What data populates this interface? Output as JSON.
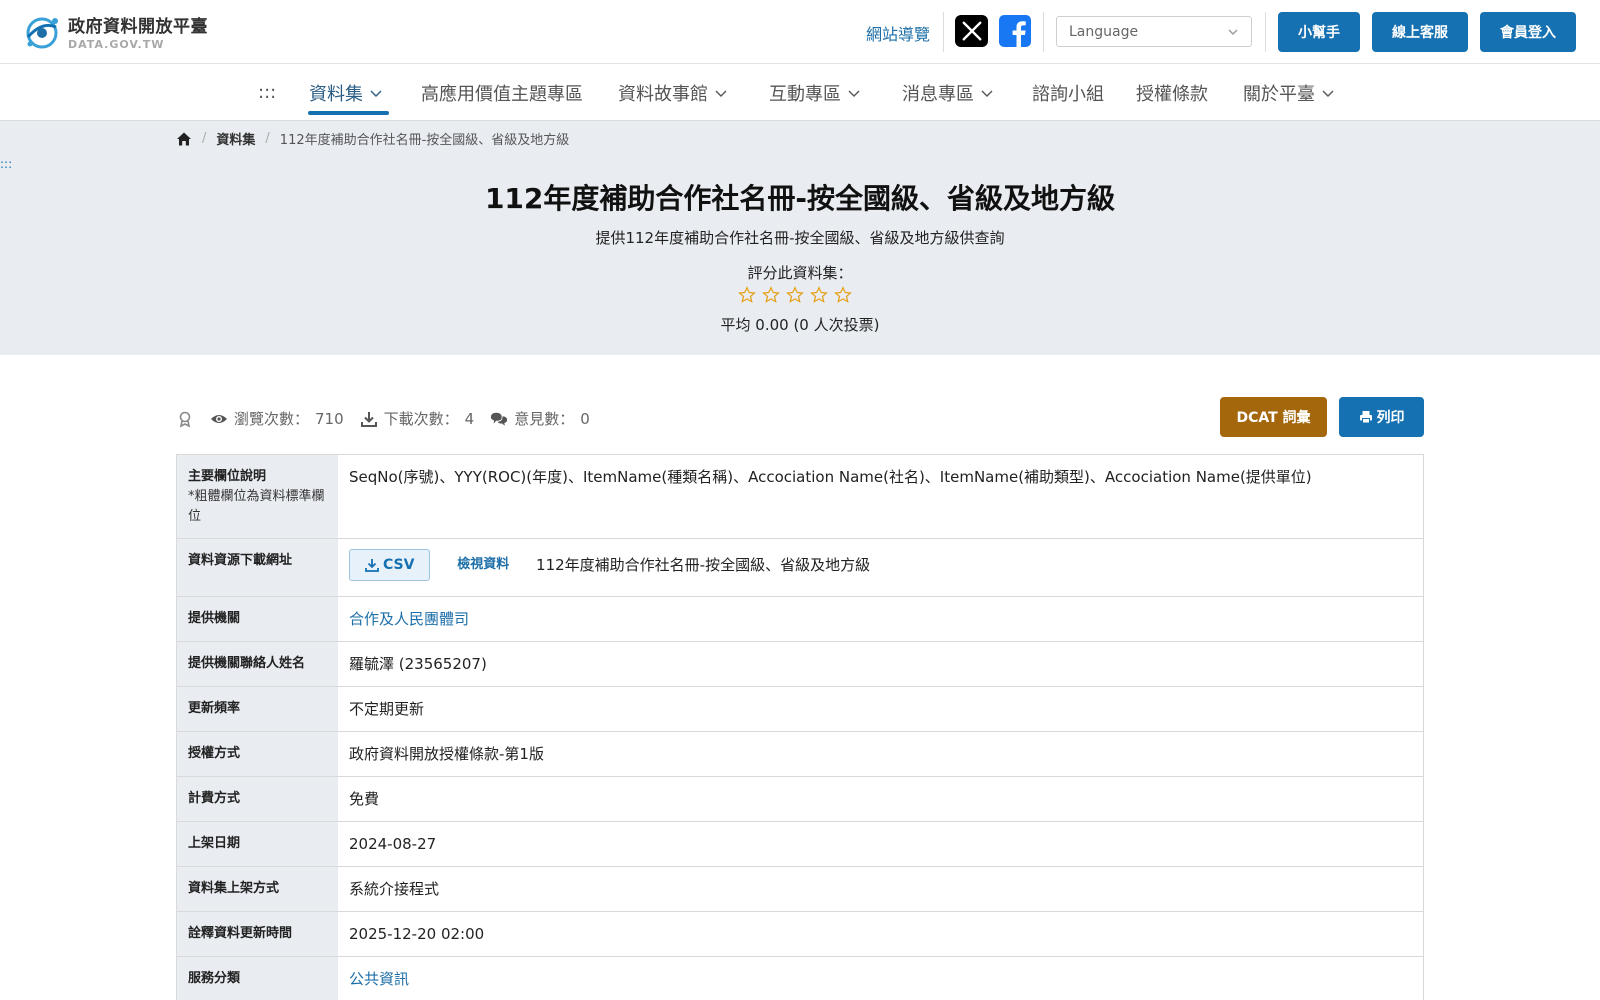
{
  "header": {
    "logo_title": "政府資料開放平臺",
    "logo_subtitle": "DATA.GOV.TW",
    "sitemap_label": "網站導覽",
    "language_placeholder": "Language",
    "helper_label": "小幫手",
    "support_label": "線上客服",
    "login_label": "會員登入"
  },
  "nav": {
    "accesskey": ":::",
    "items": [
      {
        "label": "資料集"
      },
      {
        "label": "高應用價值主題專區"
      },
      {
        "label": "資料故事館"
      },
      {
        "label": "互動專區"
      },
      {
        "label": "消息專區"
      },
      {
        "label": "諮詢小組"
      },
      {
        "label": "授權條款"
      },
      {
        "label": "關於平臺"
      }
    ]
  },
  "breadcrumb": {
    "section": "資料集",
    "current": "112年度補助合作社名冊-按全國級、省級及地方級"
  },
  "hero": {
    "accesskey": ":::",
    "title": "112年度補助合作社名冊-按全國級、省級及地方級",
    "description": "提供112年度補助合作社名冊-按全國級、省級及地方級供查詢",
    "rate_label": "評分此資料集：",
    "stars": 0,
    "average_text": "平均 0.00 (0 人次投票)"
  },
  "stats": {
    "views_label": "瀏覽次數：",
    "views": "710",
    "downloads_label": "下載次數：",
    "downloads": "4",
    "comments_label": "意見數：",
    "comments": "0"
  },
  "actions": {
    "dcat_label": "DCAT 詞彙",
    "print_label": "列印"
  },
  "details": {
    "fields_label": "主要欄位說明",
    "fields_note": "*粗體欄位為資料標準欄位",
    "fields_value": "SeqNo(序號)、YYY(ROC)(年度)、ItemName(種類名稱)、Accociation Name(社名)、ItemName(補助類型)、Accociation Name(提供單位)",
    "download_label": "資料資源下載網址",
    "csv_label": "CSV",
    "view_data_label": "檢視資料",
    "resource_name": "112年度補助合作社名冊-按全國級、省級及地方級",
    "agency_label": "提供機關",
    "agency_value": "合作及人民團體司",
    "contact_label": "提供機關聯絡人姓名",
    "contact_value": "羅毓澤 (23565207)",
    "frequency_label": "更新頻率",
    "frequency_value": "不定期更新",
    "license_label": "授權方式",
    "license_value": "政府資料開放授權條款-第1版",
    "fee_label": "計費方式",
    "fee_value": "免費",
    "published_label": "上架日期",
    "published_value": "2024-08-27",
    "method_label": "資料集上架方式",
    "method_value": "系統介接程式",
    "meta_updated_label": "詮釋資料更新時間",
    "meta_updated_value": "2025-12-20 02:00",
    "category_label": "服務分類",
    "category_value": "公共資訊"
  },
  "colors": {
    "primary": "#1571b1",
    "dcat": "#a5670c",
    "hero_bg": "#e9edf2",
    "star": "#e5a21c"
  }
}
